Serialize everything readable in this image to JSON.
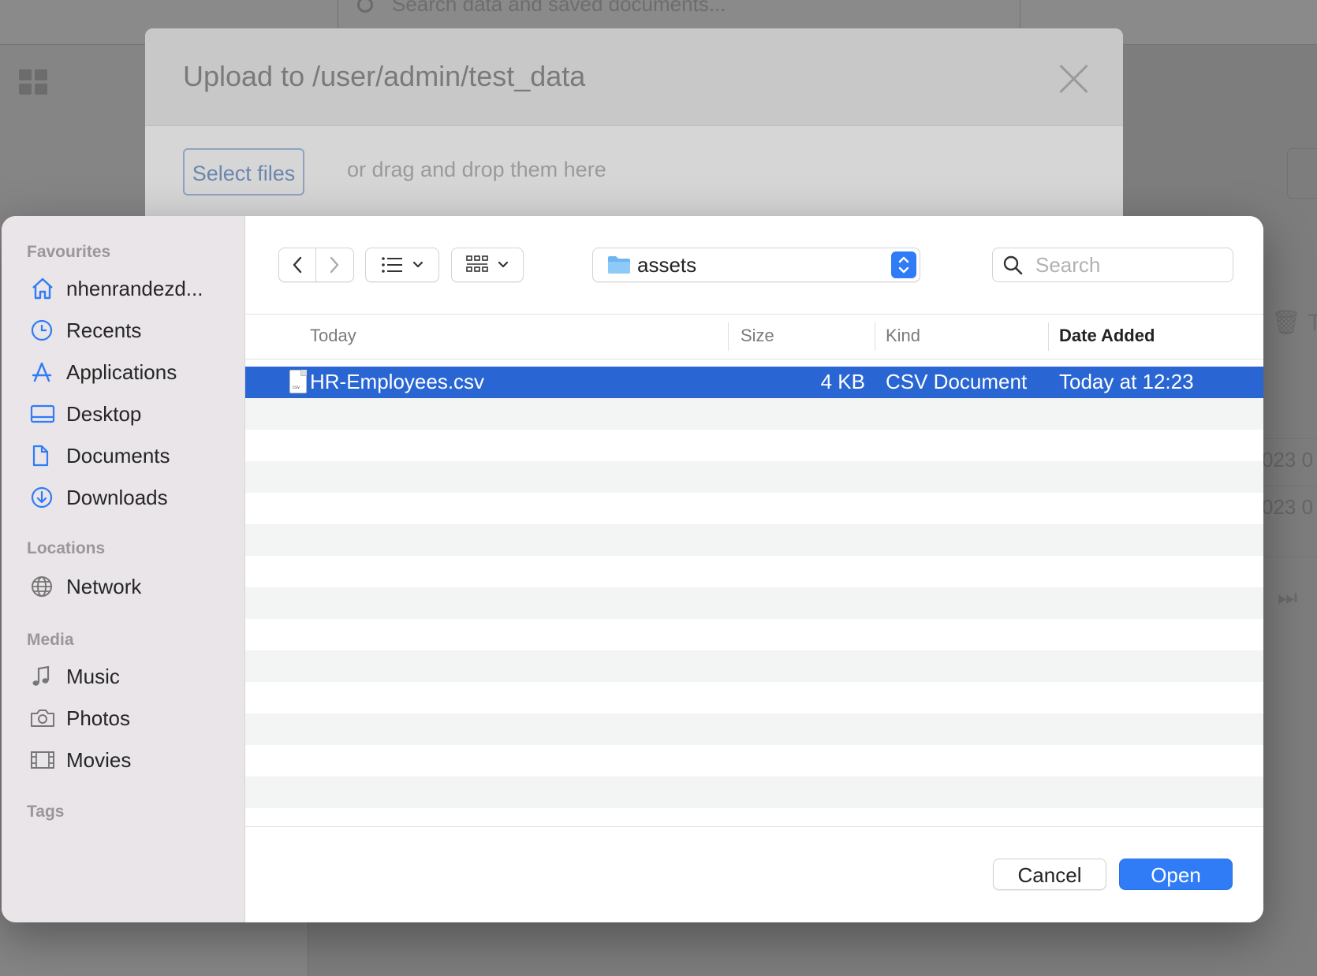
{
  "background": {
    "search_placeholder": "Search data and saved documents...",
    "trash_text": "T",
    "row_dates": [
      "023 0",
      "023 0"
    ]
  },
  "upload_modal": {
    "title": "Upload to /user/admin/test_data",
    "select_files_label": "Select files",
    "drag_hint": "or drag and drop them here"
  },
  "file_dialog": {
    "sidebar": {
      "sections": [
        {
          "title": "Favourites",
          "items": [
            {
              "label": "nhenrandezd...",
              "icon": "home-icon"
            },
            {
              "label": "Recents",
              "icon": "clock-icon"
            },
            {
              "label": "Applications",
              "icon": "applications-icon"
            },
            {
              "label": "Desktop",
              "icon": "desktop-icon"
            },
            {
              "label": "Documents",
              "icon": "document-icon"
            },
            {
              "label": "Downloads",
              "icon": "download-icon"
            }
          ]
        },
        {
          "title": "Locations",
          "items": [
            {
              "label": "Network",
              "icon": "globe-icon"
            }
          ]
        },
        {
          "title": "Media",
          "items": [
            {
              "label": "Music",
              "icon": "music-note-icon"
            },
            {
              "label": "Photos",
              "icon": "camera-icon"
            },
            {
              "label": "Movies",
              "icon": "film-icon"
            }
          ]
        },
        {
          "title": "Tags",
          "items": []
        }
      ]
    },
    "toolbar": {
      "current_folder": "assets",
      "search_placeholder": "Search"
    },
    "columns": [
      "Today",
      "Size",
      "Kind",
      "Date Added"
    ],
    "sorted_column": "Date Added",
    "files": [
      {
        "name": "HR-Employees.csv",
        "size": "4 KB",
        "kind": "CSV Document",
        "date_added": "Today at 12:23",
        "selected": true
      }
    ],
    "buttons": {
      "cancel": "Cancel",
      "open": "Open"
    },
    "colors": {
      "accent": "#2f7cf6",
      "selection": "#2966d4",
      "sidebar_icon": "#2f7cf6"
    }
  }
}
